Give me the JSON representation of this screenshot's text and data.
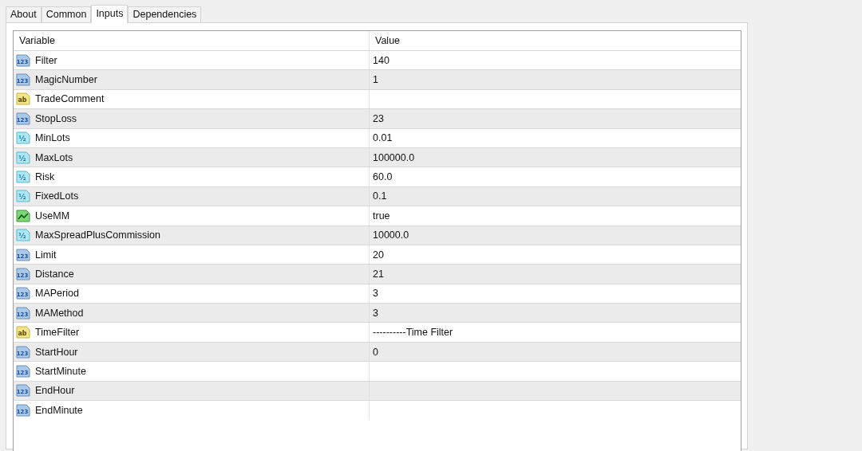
{
  "tabs": [
    {
      "label": "About",
      "selected": false
    },
    {
      "label": "Common",
      "selected": false
    },
    {
      "label": "Inputs",
      "selected": true
    },
    {
      "label": "Dependencies",
      "selected": false
    }
  ],
  "table": {
    "columns": [
      "Variable",
      "Value"
    ],
    "rows": [
      {
        "kind": "int",
        "icon_text": "123",
        "variable": "Filter",
        "value": "140"
      },
      {
        "kind": "int",
        "icon_text": "123",
        "variable": "MagicNumber",
        "value": "1"
      },
      {
        "kind": "string",
        "icon_text": "ab",
        "variable": "TradeComment"
      },
      {
        "kind": "int",
        "icon_text": "123",
        "variable": "StopLoss",
        "value": "23"
      },
      {
        "kind": "double",
        "icon_text": "½",
        "variable": "MinLots",
        "value": "0.01"
      },
      {
        "kind": "double",
        "icon_text": "½",
        "variable": "MaxLots",
        "value": "100000.0"
      },
      {
        "kind": "double",
        "icon_text": "½",
        "variable": "Risk",
        "value": "60.0"
      },
      {
        "kind": "double",
        "icon_text": "½",
        "variable": "FixedLots",
        "value": "0.1"
      },
      {
        "kind": "bool",
        "variable": "UseMM",
        "value": "true"
      },
      {
        "kind": "double",
        "icon_text": "½",
        "variable": "MaxSpreadPlusCommission",
        "value": "10000.0"
      },
      {
        "kind": "int",
        "icon_text": "123",
        "variable": "Limit",
        "value": "20"
      },
      {
        "kind": "int",
        "icon_text": "123",
        "variable": "Distance",
        "value": "21"
      },
      {
        "kind": "int",
        "icon_text": "123",
        "variable": "MAPeriod",
        "value": "3"
      },
      {
        "kind": "int",
        "icon_text": "123",
        "variable": "MAMethod",
        "value": "3"
      },
      {
        "kind": "string",
        "icon_text": "ab",
        "variable": "TimeFilter",
        "value": "----------Time Filter"
      },
      {
        "kind": "int",
        "icon_text": "123",
        "variable": "StartHour",
        "value": "0"
      },
      {
        "kind": "int",
        "icon_text": "123",
        "variable": "StartMinute"
      },
      {
        "kind": "int",
        "icon_text": "123",
        "variable": "EndHour"
      },
      {
        "kind": "int",
        "icon_text": "123",
        "variable": "EndMinute"
      }
    ]
  }
}
